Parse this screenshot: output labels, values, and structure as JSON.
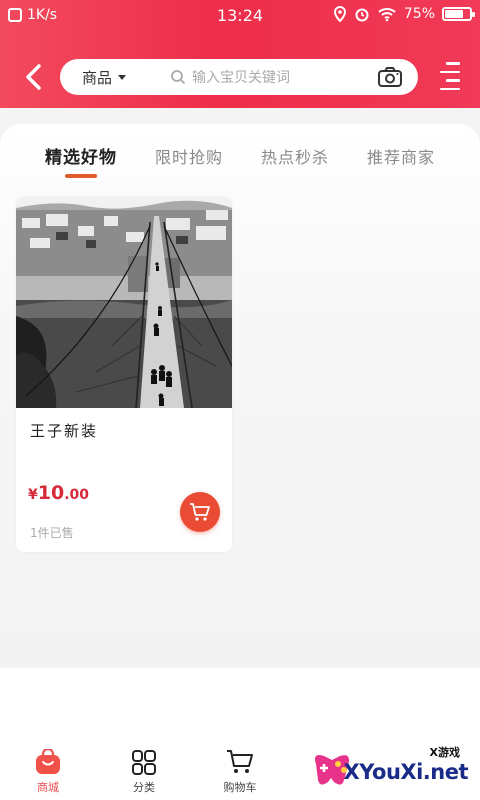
{
  "status_bar": {
    "speed": "1K/s",
    "time": "13:24",
    "battery": "75%",
    "battery_level": 0.75
  },
  "header": {
    "category_label": "商品",
    "search_placeholder": "输入宝贝关键词"
  },
  "tabs": [
    {
      "label": "精选好物",
      "active": true
    },
    {
      "label": "限时抢购",
      "active": false
    },
    {
      "label": "热点秒杀",
      "active": false
    },
    {
      "label": "推荐商家",
      "active": false
    }
  ],
  "product": {
    "name": "王子新装",
    "price_symbol": "¥",
    "price_integer": "10",
    "price_decimal": ".00",
    "sold": "1件已售"
  },
  "tabbar": [
    {
      "label": "商城",
      "icon": "shop-bag-icon",
      "active": true
    },
    {
      "label": "分类",
      "icon": "category-grid-icon",
      "active": false
    },
    {
      "label": "购物车",
      "icon": "cart-icon",
      "active": false
    }
  ],
  "watermark": {
    "small": "X游戏",
    "big": "XYouXi.net"
  },
  "colors": {
    "header_red": "#ee2e4a",
    "tab_underline": "#e25b2d",
    "price_red": "#d52a3a",
    "cart_button": "#e94b35"
  }
}
